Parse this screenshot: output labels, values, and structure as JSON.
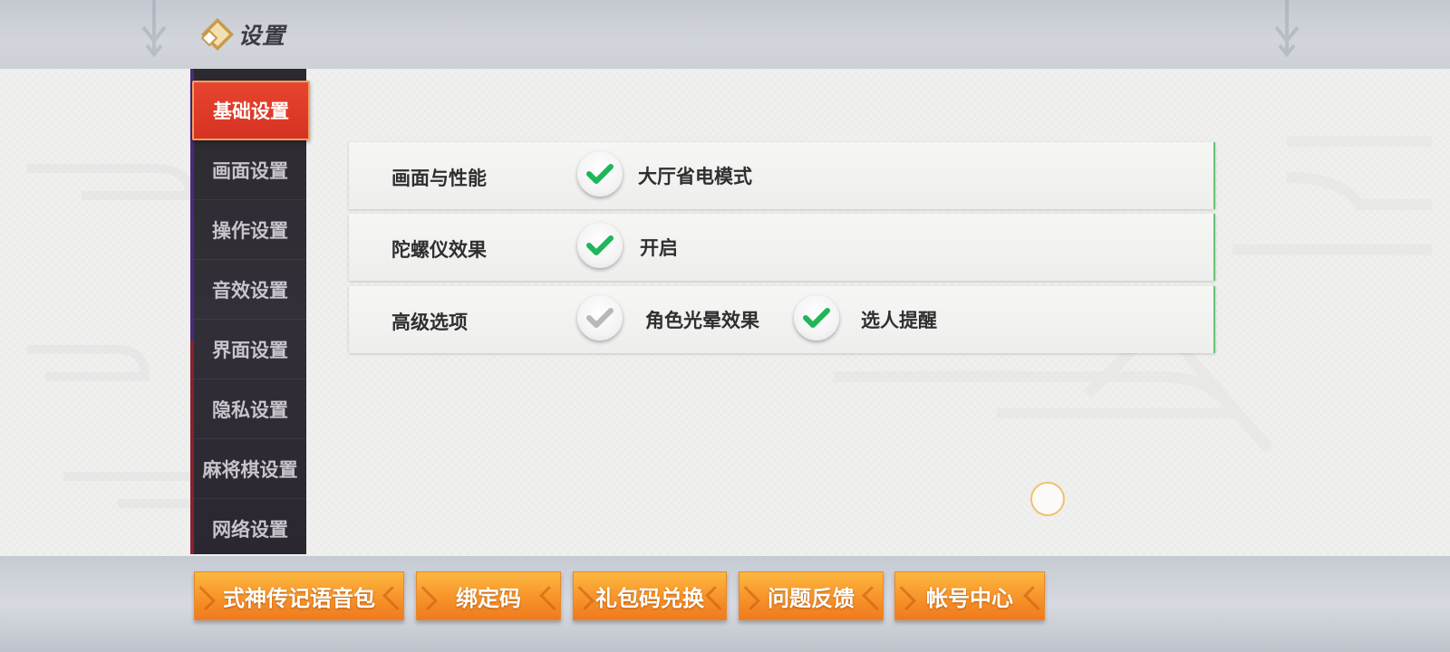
{
  "header": {
    "title": "设置",
    "logo_icon": "diamond-logo-icon"
  },
  "sidebar": {
    "items": [
      {
        "label": "基础设置",
        "active": true
      },
      {
        "label": "画面设置",
        "active": false
      },
      {
        "label": "操作设置",
        "active": false
      },
      {
        "label": "音效设置",
        "active": false
      },
      {
        "label": "界面设置",
        "active": false
      },
      {
        "label": "隐私设置",
        "active": false
      },
      {
        "label": "麻将棋设置",
        "active": false
      },
      {
        "label": "网络设置",
        "active": false
      }
    ]
  },
  "settings": {
    "rows": [
      {
        "label": "画面与性能",
        "options": [
          {
            "label": "大厅省电模式",
            "checked": true
          }
        ]
      },
      {
        "label": "陀螺仪效果",
        "options": [
          {
            "label": "开启",
            "checked": true
          }
        ]
      },
      {
        "label": "高级选项",
        "options": [
          {
            "label": "角色光晕效果",
            "checked": false
          },
          {
            "label": "选人提醒",
            "checked": true
          }
        ]
      }
    ]
  },
  "bottom_buttons": [
    {
      "label": "式神传记语音包"
    },
    {
      "label": "绑定码"
    },
    {
      "label": "礼包码兑换"
    },
    {
      "label": "问题反馈"
    },
    {
      "label": "帐号中心"
    }
  ],
  "colors": {
    "accent_active": "#e03a28",
    "check_on": "#1fb65a",
    "check_off": "#b8b8b8",
    "button_orange": "#f7932a"
  }
}
